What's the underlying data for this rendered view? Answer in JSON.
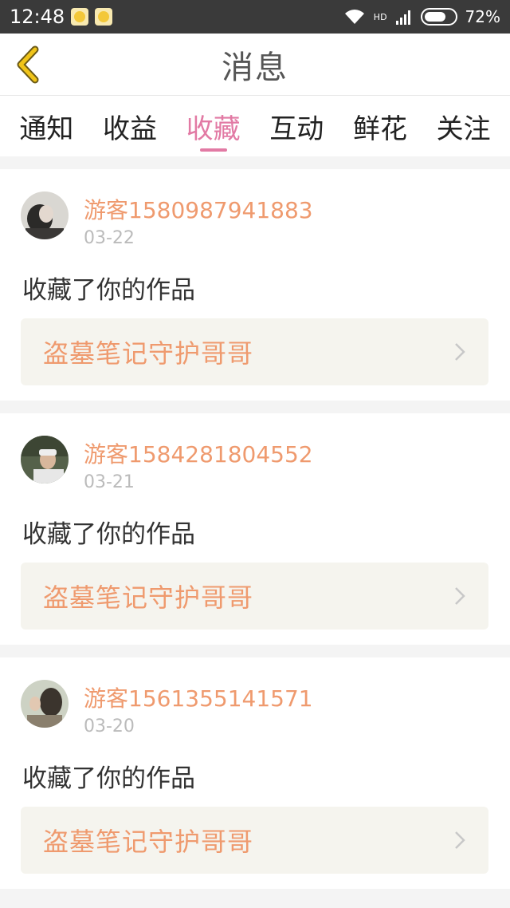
{
  "status_bar": {
    "time": "12:48",
    "battery": "72%",
    "battery_level": 0.72,
    "network": "HD"
  },
  "header": {
    "title": "消息"
  },
  "tabs": [
    {
      "label": "通知",
      "active": false
    },
    {
      "label": "收益",
      "active": false
    },
    {
      "label": "收藏",
      "active": true
    },
    {
      "label": "互动",
      "active": false
    },
    {
      "label": "鲜花",
      "active": false
    },
    {
      "label": "关注",
      "active": false
    }
  ],
  "messages": [
    {
      "user": "游客1580987941883",
      "date": "03-22",
      "action": "收藏了你的作品",
      "work": "盗墓笔记守护哥哥"
    },
    {
      "user": "游客1584281804552",
      "date": "03-21",
      "action": "收藏了你的作品",
      "work": "盗墓笔记守护哥哥"
    },
    {
      "user": "游客1561355141571",
      "date": "03-20",
      "action": "收藏了你的作品",
      "work": "盗墓笔记守护哥哥"
    }
  ],
  "colors": {
    "accent_pink": "#e27aa4",
    "username_orange": "#ef9a6e",
    "back_arrow_yellow": "#f0c419"
  }
}
